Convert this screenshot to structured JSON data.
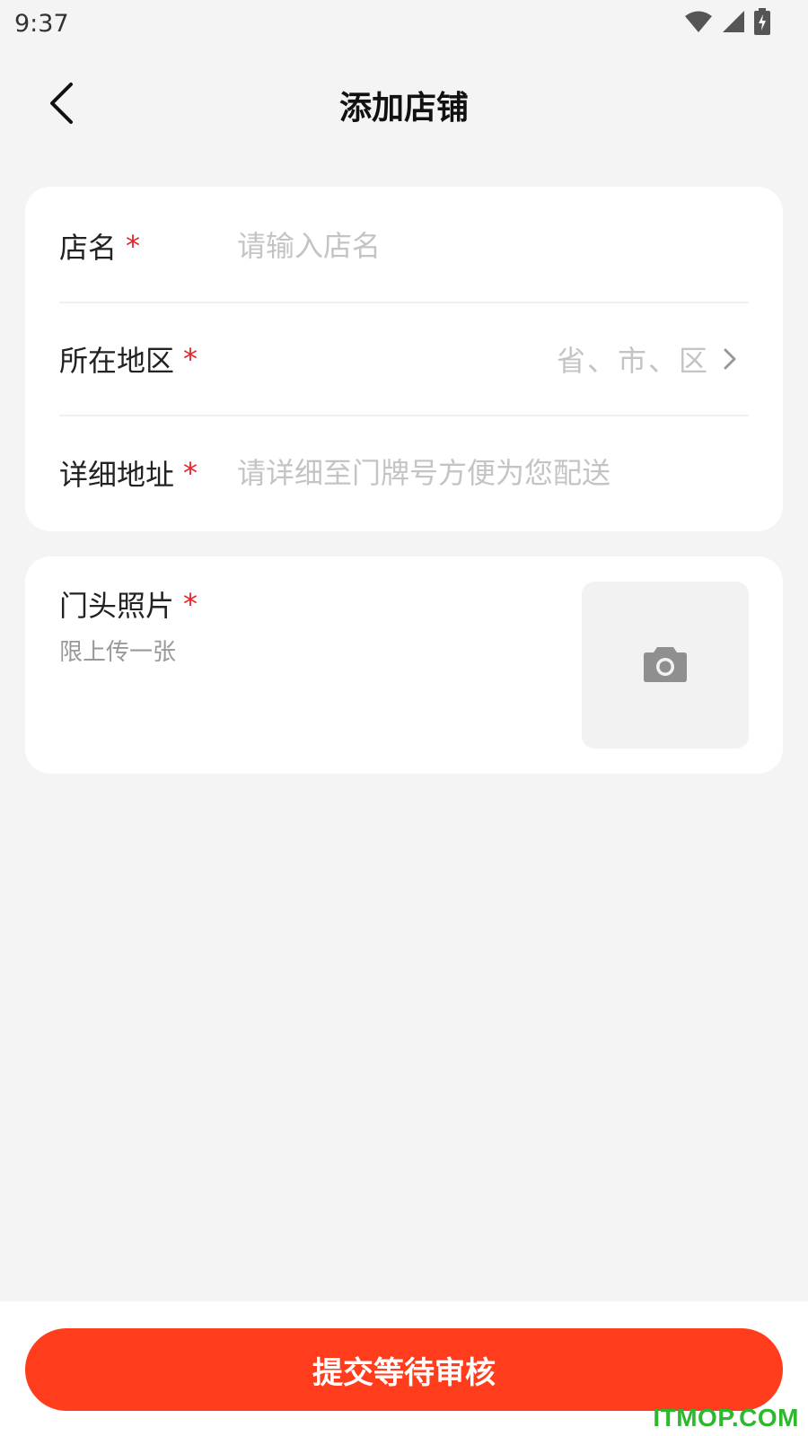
{
  "status_bar": {
    "time": "9:37",
    "icons": [
      "wifi-icon",
      "signal-icon",
      "battery-charging-icon"
    ]
  },
  "nav": {
    "back_icon": "chevron-left-icon",
    "title": "添加店铺"
  },
  "form": {
    "shop_name": {
      "label": "店名",
      "required_mark": "*",
      "placeholder": "请输入店名",
      "value": ""
    },
    "region": {
      "label": "所在地区",
      "required_mark": "*",
      "placeholder": "省、市、区",
      "icon": "chevron-right-icon"
    },
    "address": {
      "label": "详细地址",
      "required_mark": "*",
      "placeholder": "请详细至门牌号方便为您配送",
      "value": ""
    }
  },
  "photo": {
    "label": "门头照片",
    "required_mark": "*",
    "hint": "限上传一张",
    "upload_icon": "camera-icon"
  },
  "submit": {
    "label": "提交等待审核"
  },
  "watermark": "ITMOP.COM",
  "colors": {
    "accent": "#ff3d1c",
    "required": "#e8232b",
    "placeholder": "#c4c4c4",
    "background": "#f4f4f4"
  }
}
